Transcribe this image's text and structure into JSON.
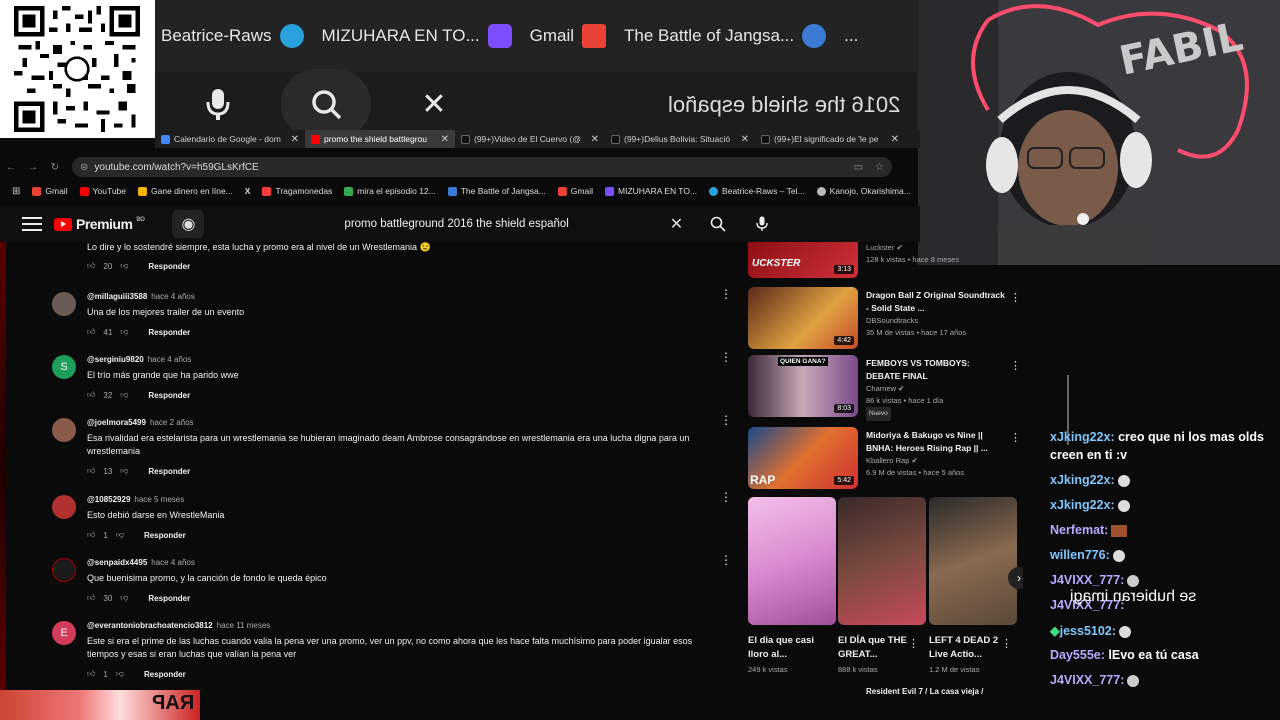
{
  "mirrored_strip": {
    "items": [
      "Beatrice-Raws",
      "MIZUHARA EN TO...",
      "Gmail",
      "The Battle of Jangsa...",
      "..."
    ],
    "query": "2016 the shield español"
  },
  "browser": {
    "tabs": [
      {
        "label": "Calendario de Google - dom",
        "color": "#4285f4"
      },
      {
        "label": "promo the shield battlegrou",
        "color": "#ff0000",
        "active": true
      },
      {
        "label": "(99+)Video de El Cuervo (@",
        "color": "#111111"
      },
      {
        "label": "(99+)Delius Bolivia: Situació",
        "color": "#111111"
      },
      {
        "label": "(99+)El significado de 'le pe",
        "color": "#111111"
      }
    ],
    "url": "youtube.com/watch?v=h59GLsKrfCE",
    "bookmarks": [
      {
        "label": "Gmail",
        "color": "#ea4335"
      },
      {
        "label": "YouTube",
        "color": "#ff0000"
      },
      {
        "label": "Gane dinero en líne...",
        "color": "#f4b400"
      },
      {
        "label": "X",
        "color": "#ffffff"
      },
      {
        "label": "Tragamonedas",
        "color": "#ff3b3b"
      },
      {
        "label": "mira el episodio 12...",
        "color": "#34a853"
      },
      {
        "label": "The Battle of Jangsa...",
        "color": "#3a7bd5"
      },
      {
        "label": "Gmail",
        "color": "#ea4335"
      },
      {
        "label": "MIZUHARA EN TO...",
        "color": "#7c4dff"
      },
      {
        "label": "Beatrice-Raws – Tel...",
        "color": "#2aa1da"
      },
      {
        "label": "Kanojo, Okarishima...",
        "color": "#bbbbbb"
      }
    ]
  },
  "youtube": {
    "logo": "Premium",
    "logo_sup": "BO",
    "search_value": "promo battleground 2016 the shield español",
    "reply_label": "Responder"
  },
  "comments": [
    {
      "user": "",
      "time": "",
      "text": "Lo dire y lo sostendré siempre, esta lucha y promo era al nivel de un Wrestlemania 😉",
      "likes": "20",
      "avatar_color": "#333333",
      "avatar_letter": ""
    },
    {
      "user": "@millaguiii3588",
      "time": "hace 4 años",
      "text": "Una de los mejores trailer de un evento",
      "likes": "41",
      "avatar_color": "#6b5a55",
      "avatar_letter": ""
    },
    {
      "user": "@serginiu9820",
      "time": "hace 4 años",
      "text": "El trío  más grande que ha parido wwe",
      "likes": "32",
      "avatar_color": "#1e9e5a",
      "avatar_letter": "S"
    },
    {
      "user": "@joelmora5499",
      "time": "hace 2 años",
      "text": "Esa rivalidad era estelarista para un wrestlemania se hubieran imaginado deam Ambrose consagrándose en wrestlemania era una lucha digna para un wrestlemania",
      "likes": "13",
      "avatar_color": "#8a5a4a",
      "avatar_letter": ""
    },
    {
      "user": "@10852929",
      "time": "hace 5 meses",
      "text": "Esto debió darse en WrestleMania",
      "likes": "1",
      "avatar_color": "#b03030",
      "avatar_letter": ""
    },
    {
      "user": "@senpaidx4495",
      "time": "hace 4 años",
      "text": "Que buenisima promo, y la canción de fondo le queda épico",
      "likes": "30",
      "avatar_color": "#1a1a1a",
      "avatar_letter": ""
    },
    {
      "user": "@everantoniobrachoatencio3812",
      "time": "hace 11 meses",
      "text": "Este si era el prime de las luchas cuando valia la pena ver una promo, ver un ppv, no como ahora que les hace falta muchísimo para poder igualar esos tiempos y esas si eran luchas que valían la pena ver",
      "likes": "1",
      "avatar_color": "#d23b5a",
      "avatar_letter": "E"
    }
  ],
  "sidebar": {
    "videos": [
      {
        "title": "",
        "channel": "Luckster",
        "meta": "128 k vistas • hace 8 meses",
        "duration": "3:13",
        "thumb": "#b8232a",
        "label": "UCKSTER"
      },
      {
        "title": "Dragon Ball Z Original Soundtrack - Solid State ...",
        "channel": "DBSoundtracks",
        "meta": "35 M de vistas • hace 17 años",
        "duration": "4:42",
        "thumb": "#c24a2a"
      },
      {
        "title": "FEMBOYS VS TOMBOYS: DEBATE FINAL",
        "channel": "Charnew",
        "meta": "86 k vistas • hace 1 día",
        "duration": "8:03",
        "thumb": "#7a4a8a",
        "badge": "Nuevo",
        "label": "QUIEN GANA?"
      },
      {
        "title": "Midoriya & Bakugo vs Nine || BNHA: Heroes Rising Rap || ...",
        "channel": "Kballero Rap",
        "meta": "6.9 M de vistas • hace 5 años",
        "duration": "5:42",
        "thumb": "#2a6ab0",
        "label": "RAP"
      }
    ],
    "shorts": [
      {
        "title": "El dia que casi lloro al...",
        "meta": "249 k vistas",
        "thumb": "#d88ad0"
      },
      {
        "title": "El DÍA que THE GREAT...",
        "meta": "888 k vistas",
        "thumb": "#7a4a40"
      },
      {
        "title": "LEFT 4 DEAD 2 Live Actio...",
        "meta": "1.2 M de vistas",
        "thumb": "#5a4a3a"
      }
    ],
    "next_title": "Resident Evil 7 / La casa vieja /"
  },
  "chat": {
    "messages": [
      {
        "user": "xJking22x:",
        "text": "creo que ni los mas olds",
        "cls": "u2"
      },
      {
        "user": "",
        "text": "creen en ti :v",
        "cls": ""
      },
      {
        "user": "xJking22x:",
        "text": "",
        "cls": "u2"
      },
      {
        "user": "xJking22x:",
        "text": "",
        "cls": "u2"
      },
      {
        "user": "Nerfemat:",
        "text": "",
        "cls": "u"
      },
      {
        "user": "willen776:",
        "text": "",
        "cls": "u2"
      },
      {
        "user": "J4VIXX_777:",
        "text": "",
        "cls": "u"
      },
      {
        "user": "J4VIXX_777:",
        "text": "",
        "cls": "u"
      },
      {
        "user": "jess5102:",
        "text": "",
        "cls": "u2"
      },
      {
        "user": "Day555e:",
        "text": "lEvo ea tú casa",
        "cls": "u"
      },
      {
        "user": "J4VIXX_777:",
        "text": "",
        "cls": "u"
      }
    ],
    "overlay": "se hubieran imagi"
  },
  "colors": {
    "accent": "#ff0000",
    "bg": "#0f0f0f"
  }
}
